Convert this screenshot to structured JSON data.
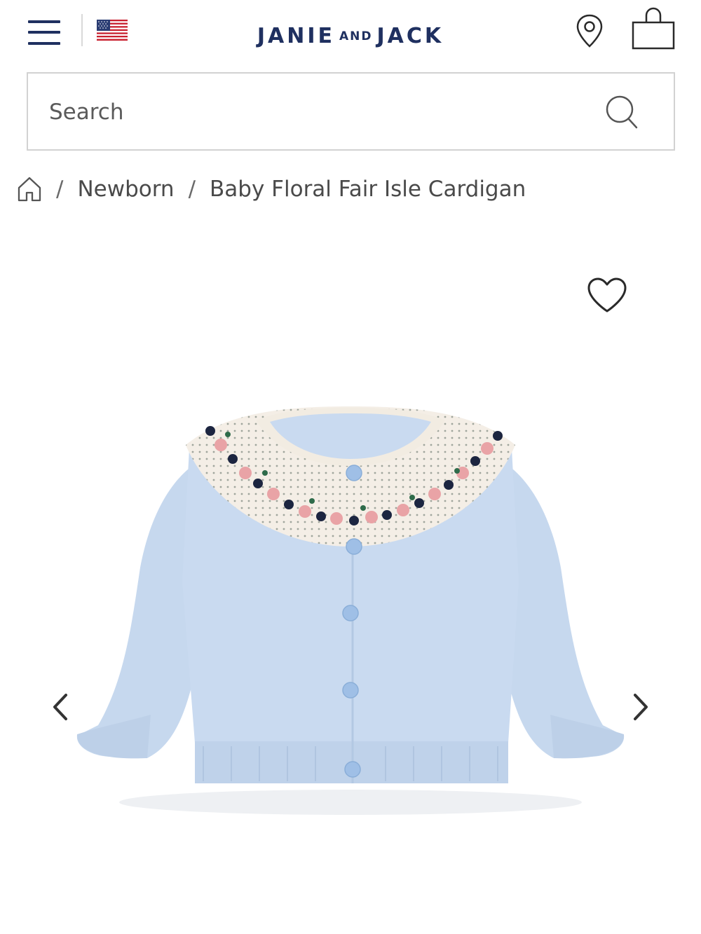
{
  "header": {
    "brand_main_left": "JANIE",
    "brand_and": "AND",
    "brand_main_right": "JACK",
    "menu_icon": "hamburger-menu-icon",
    "flag_icon": "us-flag-icon",
    "location_icon": "location-pin-icon",
    "bag_icon": "shopping-bag-icon"
  },
  "search": {
    "placeholder": "Search",
    "value": "",
    "icon": "search-icon"
  },
  "breadcrumb": {
    "home_icon": "home-icon",
    "separator": "/",
    "items": [
      "Newborn",
      "Baby Floral Fair Isle Cardigan"
    ]
  },
  "product": {
    "wishlist_icon": "heart-icon",
    "prev_icon": "chevron-left-icon",
    "next_icon": "chevron-right-icon"
  },
  "colors": {
    "brand_navy": "#1f3060",
    "cardigan_blue": "#c9daf0",
    "yoke_cream": "#f4eee6",
    "floral_pink": "#e9a3a6",
    "floral_navy": "#1c2540"
  }
}
